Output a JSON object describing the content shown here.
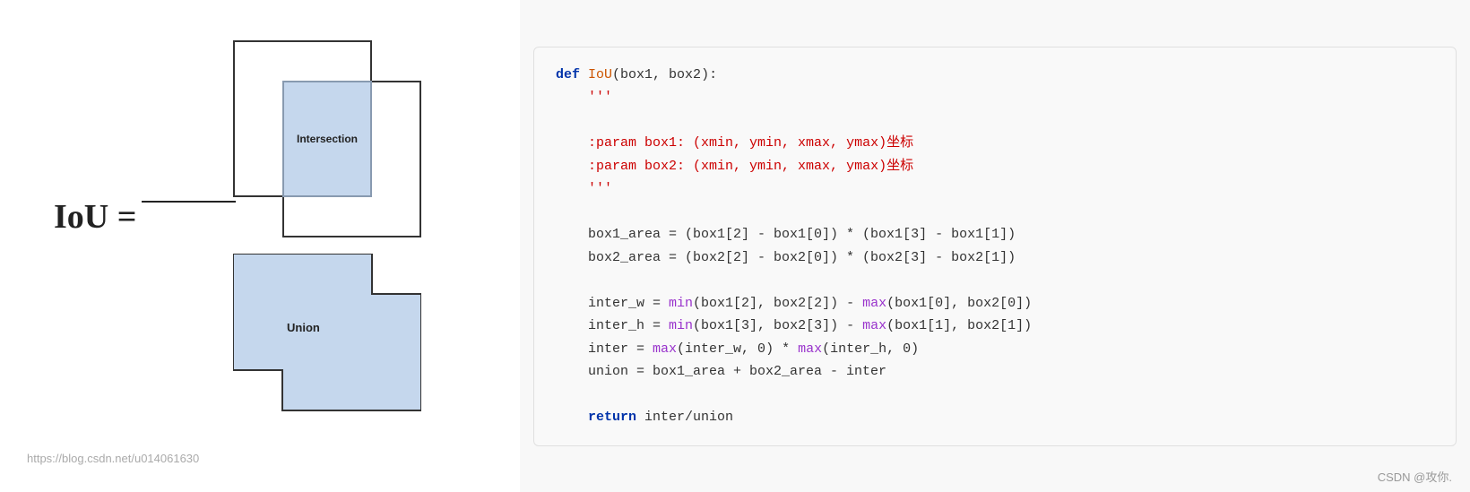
{
  "diagram": {
    "iou_label": "IoU =",
    "intersection_label": "Intersection",
    "union_label": "Union",
    "watermark": "https://blog.csdn.net/u014061630"
  },
  "code": {
    "lines": [
      {
        "id": "l1",
        "content": "def IoU(box1, box2):"
      },
      {
        "id": "l2",
        "content": "    '''"
      },
      {
        "id": "l3",
        "content": ""
      },
      {
        "id": "l4",
        "content": "    :param box1: (xmin, ymin, xmax, ymax)坐标"
      },
      {
        "id": "l5",
        "content": "    :param box2: (xmin, ymin, xmax, ymax)坐标"
      },
      {
        "id": "l6",
        "content": "    '''"
      },
      {
        "id": "l7",
        "content": ""
      },
      {
        "id": "l8",
        "content": "    box1_area = (box1[2] - box1[0]) * (box1[3] - box1[1])"
      },
      {
        "id": "l9",
        "content": "    box2_area = (box2[2] - box2[0]) * (box2[3] - box2[1])"
      },
      {
        "id": "l10",
        "content": ""
      },
      {
        "id": "l11",
        "content": "    inter_w = min(box1[2], box2[2]) - max(box1[0], box2[0])"
      },
      {
        "id": "l12",
        "content": "    inter_h = min(box1[3], box2[3]) - max(box1[1], box2[1])"
      },
      {
        "id": "l13",
        "content": "    inter = max(inter_w, 0) * max(inter_h, 0)"
      },
      {
        "id": "l14",
        "content": "    union = box1_area + box2_area - inter"
      },
      {
        "id": "l15",
        "content": ""
      },
      {
        "id": "l16",
        "content": "    return inter/union"
      }
    ]
  },
  "csdn": {
    "watermark": "CSDN @攻你."
  }
}
